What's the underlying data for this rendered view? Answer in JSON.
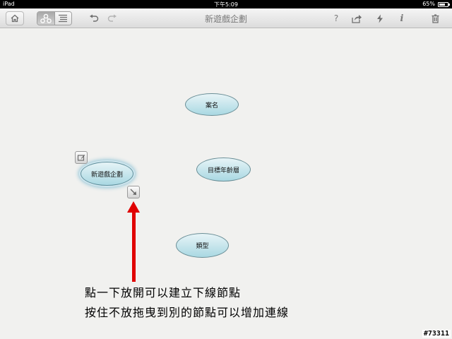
{
  "status_bar": {
    "carrier": "iPad",
    "time": "下午5:09",
    "battery": "65%"
  },
  "toolbar": {
    "title": "新遊戲企劃",
    "help_label": "?",
    "info_label": "i"
  },
  "icons": {
    "home": "home-icon",
    "mindmap_view": "mindmap-icon",
    "outline_view": "outline-icon",
    "undo": "undo-icon",
    "redo": "redo-icon",
    "share": "share-icon",
    "flash": "flash-icon",
    "trash": "trash-icon",
    "node_note": "note-icon",
    "node_connect": "connect-arrow-icon"
  },
  "nodes": {
    "root": "新遊戲企劃",
    "case_name": "案名",
    "target_age": "目標年齡層",
    "genre": "類型"
  },
  "annotation": {
    "line1": "點一下放開可以建立下線節點",
    "line2": "按住不放拖曳到別的節點可以增加連線"
  },
  "watermark": "#73311",
  "colors": {
    "arrow": "#e00000",
    "node_fill": "#a9d8e2"
  }
}
